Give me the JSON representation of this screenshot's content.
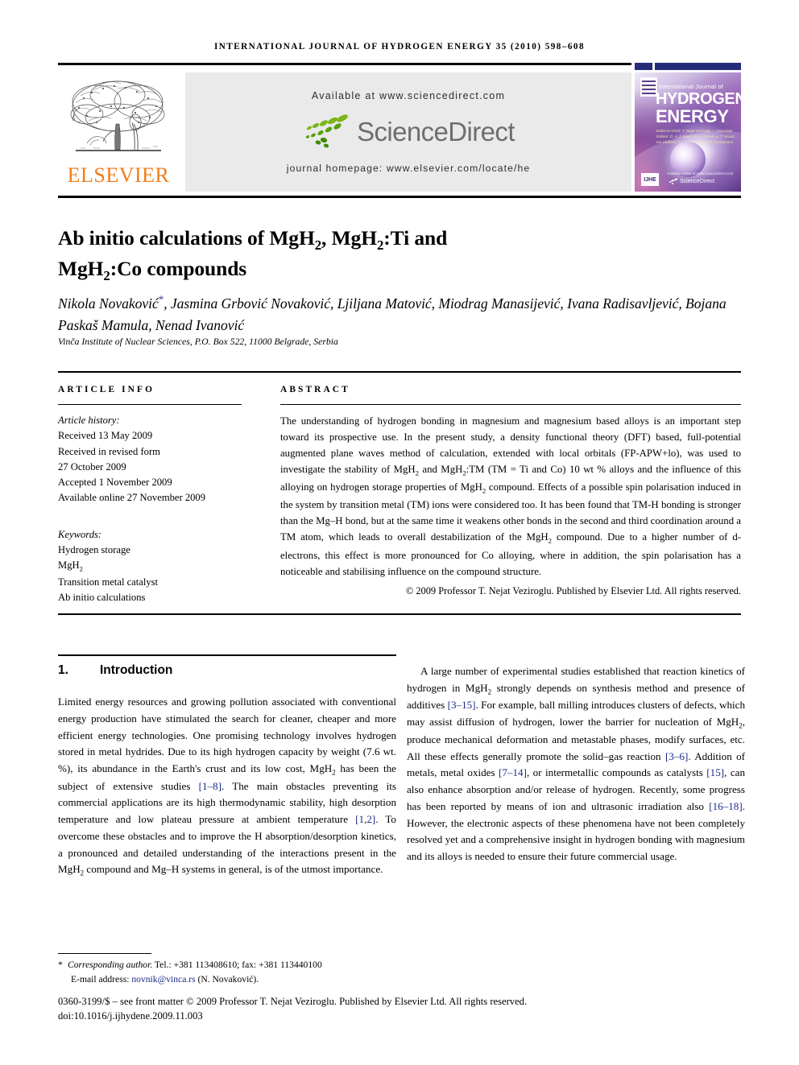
{
  "running_head": "International Journal of Hydrogen Energy 35 (2010) 598–608",
  "masthead": {
    "publisher_name": "ELSEVIER",
    "available_at": "Available at www.sciencedirect.com",
    "logo_word": "ScienceDirect",
    "journal_homepage": "journal homepage: www.elsevier.com/locate/he",
    "cover": {
      "line_small": "International Journal of",
      "line_1": "HYDROGEN",
      "line_2": "ENERGY",
      "editors": "Editor-in-Chief: T. Nejat Veziroglu — Associate Editors: D. A. J. Rand, M. A. Rosen, A. T. Stuart, Ian Stafford, C.-J. Winter and B. E. Pontecorvo",
      "available_note": "Available online at www.sciencedirect.com",
      "badge": "IJHE",
      "sciencedirect": "ScienceDirect"
    }
  },
  "title": {
    "line1_a": "Ab initio calculations of MgH",
    "line1_sub": "2",
    "line1_b": ", MgH",
    "line1_sub2": "2",
    "line1_c": ":Ti and",
    "line2_a": "MgH",
    "line2_sub": "2",
    "line2_b": ":Co compounds"
  },
  "authors": {
    "text": "Nikola Novaković*, Jasmina Grbović Novaković, Ljiljana Matović, Miodrag Manasijević, Ivana Radisavljević, Bojana Paskaš Mamula, Nenad Ivanović",
    "part1": "Nikola Novaković",
    "star": "*",
    "part2": ", Jasmina Grbović Novaković, Ljiljana Matović, Miodrag Manasijević, Ivana Radisavljević, Bojana Paskaš Mamula, Nenad Ivanović",
    "affiliation": "Vinča Institute of Nuclear Sciences, P.O. Box 522, 11000 Belgrade, Serbia"
  },
  "article_info": {
    "label": "article info",
    "history_label": "Article history:",
    "history": [
      "Received 13 May 2009",
      "Received in revised form",
      "27 October 2009",
      "Accepted 1 November 2009",
      "Available online 27 November 2009"
    ],
    "keywords_label": "Keywords:",
    "keywords": [
      "Hydrogen storage",
      "MgH2",
      "Transition metal catalyst",
      "Ab initio calculations"
    ],
    "keyword_mgh2_base": "MgH",
    "keyword_mgh2_sub": "2"
  },
  "abstract": {
    "label": "abstract",
    "p1_a": "The understanding of hydrogen bonding in magnesium and magnesium based alloys is an important step toward its prospective use. In the present study, a density functional theory (DFT) based, full-potential augmented plane waves method of calculation, extended with local orbitals (FP-APW+lo), was used to investigate the stability of MgH",
    "p1_b": " and MgH",
    "p1_c": ":TM (TM = Ti and Co) 10 wt % alloys and the influence of this alloying on hydrogen storage properties of MgH",
    "p1_d": " compound. Effects of a possible spin polarisation induced in the system by transition metal (TM) ions were considered too. It has been found that TM-H bonding is stronger than the Mg–H bond, but at the same time it weakens other bonds in the second and third coordination around a TM atom, which leads to overall destabilization of the MgH",
    "p1_e": " compound. Due to a higher number of d-electrons, this effect is more pronounced for Co alloying, where in addition, the spin polarisation has a noticeable and stabilising influence on the compound structure.",
    "sub": "2",
    "copyright": "© 2009 Professor T. Nejat Veziroglu. Published by Elsevier Ltd. All rights reserved."
  },
  "section": {
    "number": "1.",
    "title": "Introduction"
  },
  "body": {
    "left_a": "Limited energy resources and growing pollution associated with conventional energy production have stimulated the search for cleaner, cheaper and more efficient energy technologies. One promising technology involves hydrogen stored in metal hydrides. Due to its high hydrogen capacity by weight (7.6 wt. %), its abundance in the Earth's crust and its low cost, MgH",
    "left_b": " has been the subject of extensive studies ",
    "left_ref1": "[1–8]",
    "left_c": ". The main obstacles preventing its commercial applications are its high thermodynamic stability, high desorption temperature and low plateau pressure at ambient temperature ",
    "left_ref2": "[1,2]",
    "left_d": ". To overcome these obstacles and to improve the H absorption/desorption kinetics, a pronounced and detailed understanding of the interactions present in the MgH",
    "left_e": " compound and Mg–H systems in general, is of the utmost importance.",
    "right_a": "A large number of experimental studies established that reaction kinetics of hydrogen in MgH",
    "right_b": " strongly depends on synthesis method and presence of additives ",
    "right_ref1": "[3–15]",
    "right_c": ". For example, ball milling introduces clusters of defects, which may assist diffusion of hydrogen, lower the barrier for nucleation of MgH",
    "right_d": ", produce mechanical deformation and metastable phases, modify surfaces, etc. All these effects generally promote the solid–gas reaction ",
    "right_ref2": "[3–6]",
    "right_e": ". Addition of metals, metal oxides ",
    "right_ref3": "[7–14]",
    "right_f": ", or intermetallic compounds as catalysts ",
    "right_ref4": "[15]",
    "right_g": ", can also enhance absorption and/or release of hydrogen. Recently, some progress has been reported by means of ion and ultrasonic irradiation also ",
    "right_ref5": "[16–18]",
    "right_h": ". However, the electronic aspects of these phenomena have not been completely resolved yet and a comprehensive insight in hydrogen bonding with magnesium and its alloys is needed to ensure their future commercial usage.",
    "sub": "2"
  },
  "footer": {
    "star": "*",
    "corresponding_label": "Corresponding author.",
    "corresponding_contact": " Tel.: +381 113408610; fax: +381 113440100",
    "email_label": "E-mail address:",
    "email": "novnik@vinca.rs",
    "email_owner": "(N. Novaković).",
    "issn_line": "0360-3199/$ – see front matter © 2009 Professor T. Nejat Veziroglu. Published by Elsevier Ltd. All rights reserved.",
    "doi": "doi:10.1016/j.ijhydene.2009.11.003"
  },
  "colors": {
    "link": "#1b2a86",
    "elsevier_orange": "#f07d1a",
    "sciencedirect_green": "#6aa61f",
    "sciencedirect_gray": "#6e6e6e",
    "cover_navy": "#262b78",
    "banner_gray": "#eaeaea"
  }
}
